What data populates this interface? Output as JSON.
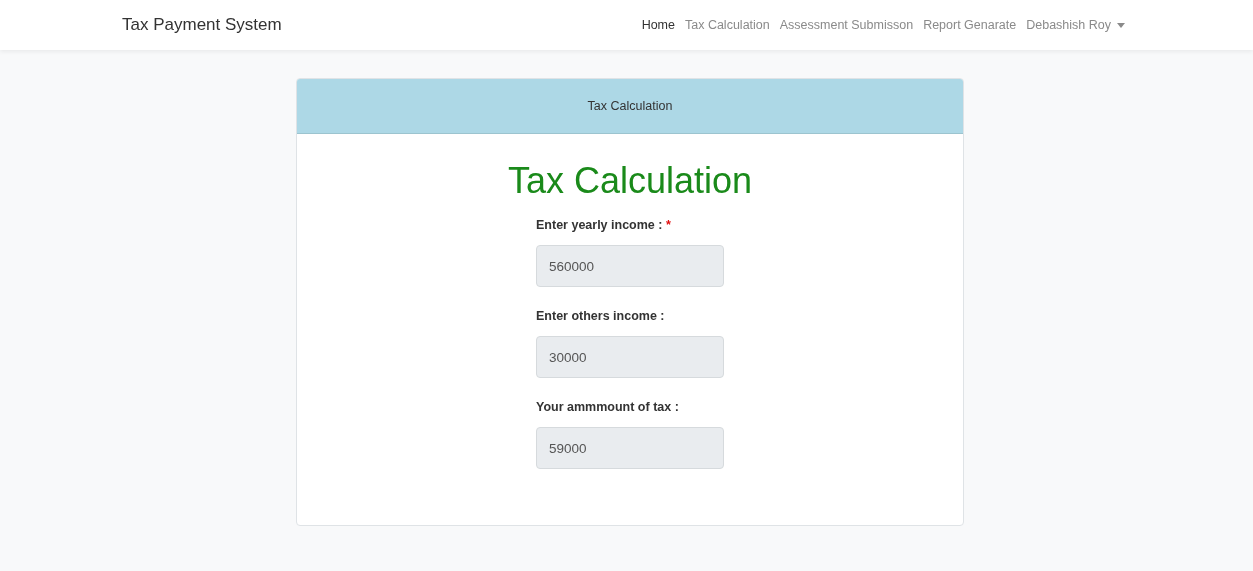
{
  "navbar": {
    "brand": "Tax Payment System",
    "links": [
      {
        "label": "Home",
        "selected": true
      },
      {
        "label": "Tax Calculation",
        "selected": false
      },
      {
        "label": "Assessment Submisson",
        "selected": false
      },
      {
        "label": "Report Genarate",
        "selected": false
      }
    ],
    "user_menu": {
      "label": "Debashish Roy"
    }
  },
  "card": {
    "header": "Tax Calculation",
    "title": "Tax Calculation",
    "fields": [
      {
        "label": "Enter yearly income :",
        "required_mark": "*",
        "value": "560000",
        "disabled": true
      },
      {
        "label": "Enter others income :",
        "value": "30000",
        "disabled": true
      },
      {
        "label": "Your ammmount of tax :",
        "value": "59000",
        "disabled": true
      }
    ]
  }
}
